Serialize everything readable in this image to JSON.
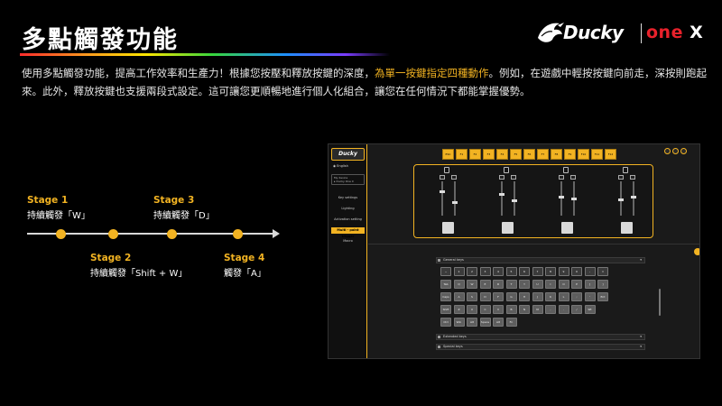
{
  "slide": {
    "title": "多點觸發功能",
    "desc_before": "使用多點觸發功能，提高工作效率和生產力！根據您按壓和釋放按鍵的深度，",
    "desc_highlight": "為單一按鍵指定四種動作",
    "desc_after": "。例如，在遊戲中輕按按鍵向前走，深按則跑起來。此外，釋放按鍵也支援兩段式設定。這可讓您更順暢地進行個人化組合，讓您在任何情況下都能掌握優勢。"
  },
  "logo": {
    "brand": "Ducky",
    "model_main": "one",
    "model_x": "X"
  },
  "stages": [
    {
      "title": "Stage 1",
      "text": "持續觸發「W」"
    },
    {
      "title": "Stage 2",
      "text": "持續觸發「Shift + W」"
    },
    {
      "title": "Stage 3",
      "text": "持續觸發「D」"
    },
    {
      "title": "Stage 4",
      "text": "觸發「A」"
    }
  ],
  "app": {
    "logo": "Ducky",
    "language": "English",
    "device_label": "My device",
    "device_name": "Ducky One X",
    "menu": [
      "Key settings",
      "Lighting",
      "Activation setting",
      "Multi - point trigger",
      "Macro"
    ],
    "active_menu_index": 3,
    "accent": "#f2b322",
    "top_keys": [
      "ESC",
      "F1",
      "F2",
      "F3",
      "F4",
      "F5",
      "F6",
      "F7",
      "F8",
      "F9",
      "F10",
      "F11",
      "F12"
    ],
    "sections": [
      "General keys",
      "Extended keys",
      "Special keys"
    ],
    "general_keys_rows": [
      [
        "~",
        "1",
        "2",
        "3",
        "4",
        "5",
        "6",
        "7",
        "8",
        "9",
        "0",
        "-",
        "="
      ],
      [
        "Tab",
        "Q",
        "W",
        "E",
        "R",
        "T",
        "Y",
        "U",
        "I",
        "O",
        "P",
        "[",
        "]"
      ],
      [
        "Caps",
        "A",
        "S",
        "D",
        "F",
        "G",
        "H",
        "J",
        "K",
        "L",
        ";",
        "'",
        "Ent"
      ],
      [
        "Shift",
        "Z",
        "X",
        "C",
        "V",
        "B",
        "N",
        "M",
        ",",
        ".",
        "/",
        "Sft"
      ],
      [
        "Ctrl",
        "Win",
        "Alt",
        "Space",
        "Alt",
        "Fn"
      ]
    ]
  }
}
